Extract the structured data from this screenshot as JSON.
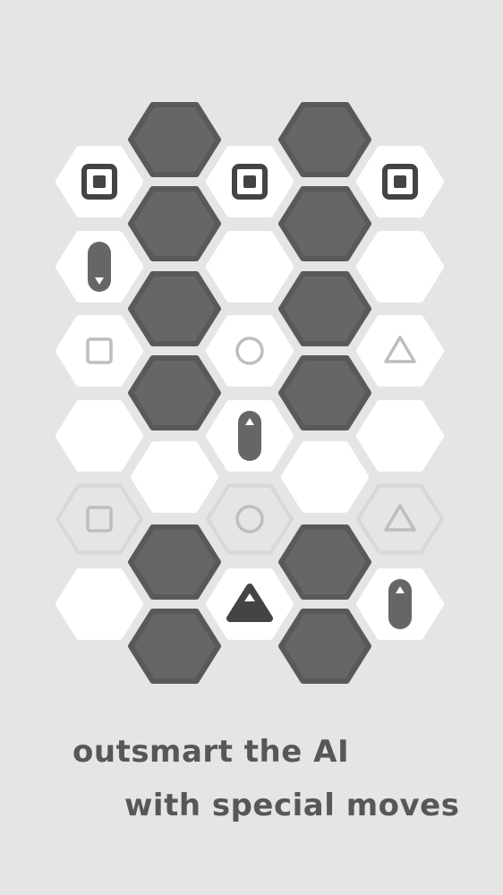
{
  "colors": {
    "background": "#e4e5e4",
    "hex_dark": "#666666",
    "hex_dark_stroke": "#595959",
    "hex_light": "#ffffff",
    "hex_ghost_stroke": "#d7d8d7",
    "piece_dark": "#444444",
    "piece_faint": "#bebebe",
    "text": "#575757"
  },
  "caption": {
    "line1": "outsmart the AI",
    "line2": "with special moves"
  },
  "board": {
    "columns": 5,
    "rows": 7,
    "cells": [
      {
        "col": 0,
        "row": 0,
        "tile": "light",
        "piece": "square-target"
      },
      {
        "col": 0,
        "row": 1,
        "tile": "light",
        "piece": "pill-down"
      },
      {
        "col": 0,
        "row": 2,
        "tile": "light",
        "piece": "square-outline"
      },
      {
        "col": 0,
        "row": 3,
        "tile": "light",
        "piece": null
      },
      {
        "col": 0,
        "row": 4,
        "tile": "ghost",
        "piece": "square-outline"
      },
      {
        "col": 0,
        "row": 5,
        "tile": "light",
        "piece": null
      },
      {
        "col": 1,
        "row": 0,
        "tile": "dark",
        "piece": null
      },
      {
        "col": 1,
        "row": 1,
        "tile": "dark",
        "piece": null
      },
      {
        "col": 1,
        "row": 2,
        "tile": "dark",
        "piece": null
      },
      {
        "col": 1,
        "row": 3,
        "tile": "dark",
        "piece": null
      },
      {
        "col": 1,
        "row": 4,
        "tile": "light",
        "piece": null
      },
      {
        "col": 1,
        "row": 5,
        "tile": "dark",
        "piece": null
      },
      {
        "col": 1,
        "row": 6,
        "tile": "dark",
        "piece": null
      },
      {
        "col": 2,
        "row": 0,
        "tile": "light",
        "piece": "square-target"
      },
      {
        "col": 2,
        "row": 1,
        "tile": "light",
        "piece": null
      },
      {
        "col": 2,
        "row": 2,
        "tile": "light",
        "piece": "circle-outline"
      },
      {
        "col": 2,
        "row": 3,
        "tile": "light",
        "piece": "pill-up"
      },
      {
        "col": 2,
        "row": 4,
        "tile": "ghost",
        "piece": "circle-outline"
      },
      {
        "col": 2,
        "row": 5,
        "tile": "light",
        "piece": "triangle-filled"
      },
      {
        "col": 3,
        "row": 0,
        "tile": "dark",
        "piece": null
      },
      {
        "col": 3,
        "row": 1,
        "tile": "dark",
        "piece": null
      },
      {
        "col": 3,
        "row": 2,
        "tile": "dark",
        "piece": null
      },
      {
        "col": 3,
        "row": 3,
        "tile": "dark",
        "piece": null
      },
      {
        "col": 3,
        "row": 4,
        "tile": "light",
        "piece": null
      },
      {
        "col": 3,
        "row": 5,
        "tile": "dark",
        "piece": null
      },
      {
        "col": 3,
        "row": 6,
        "tile": "dark",
        "piece": null
      },
      {
        "col": 4,
        "row": 0,
        "tile": "light",
        "piece": "square-target"
      },
      {
        "col": 4,
        "row": 1,
        "tile": "light",
        "piece": null
      },
      {
        "col": 4,
        "row": 2,
        "tile": "light",
        "piece": "triangle-outline"
      },
      {
        "col": 4,
        "row": 3,
        "tile": "light",
        "piece": null
      },
      {
        "col": 4,
        "row": 4,
        "tile": "ghost",
        "piece": "triangle-outline"
      },
      {
        "col": 4,
        "row": 5,
        "tile": "light",
        "piece": "pill-up"
      }
    ]
  }
}
